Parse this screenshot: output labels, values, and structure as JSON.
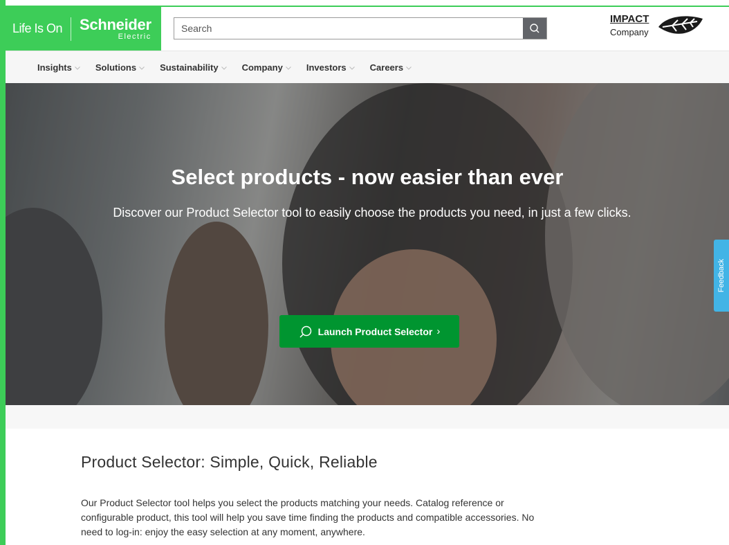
{
  "header": {
    "tagline": "Life Is On",
    "brand_name": "Schneider",
    "brand_sub": "Electric",
    "search_placeholder": "Search",
    "impact_title": "IMPACT",
    "impact_sub": "Company"
  },
  "nav": {
    "items": [
      {
        "label": "Insights"
      },
      {
        "label": "Solutions"
      },
      {
        "label": "Sustainability"
      },
      {
        "label": "Company"
      },
      {
        "label": "Investors"
      },
      {
        "label": "Careers"
      }
    ]
  },
  "hero": {
    "title": "Select products - now easier than ever",
    "subtitle": "Discover our Product Selector tool to easily choose the products you need, in just a few clicks.",
    "button_label": "Launch Product Selector",
    "button_chevron": "›"
  },
  "feedback": {
    "label": "Feedback"
  },
  "section": {
    "title": "Product Selector: Simple, Quick, Reliable",
    "body": "Our Product Selector tool helps you select the products matching your needs. Catalog reference or configurable product, this tool will help you save time finding the products and compatible accessories. No need to log-in: enjoy the easy selection at any moment, anywhere."
  },
  "colors": {
    "brand_green": "#3dcd58",
    "button_green": "#009530",
    "feedback_blue": "#42b4e6",
    "search_button_gray": "#626469"
  },
  "icons": {
    "search": "search-icon",
    "launch": "search-icon",
    "leaf": "leaf-icon",
    "chevron": "chevron-down-icon"
  }
}
